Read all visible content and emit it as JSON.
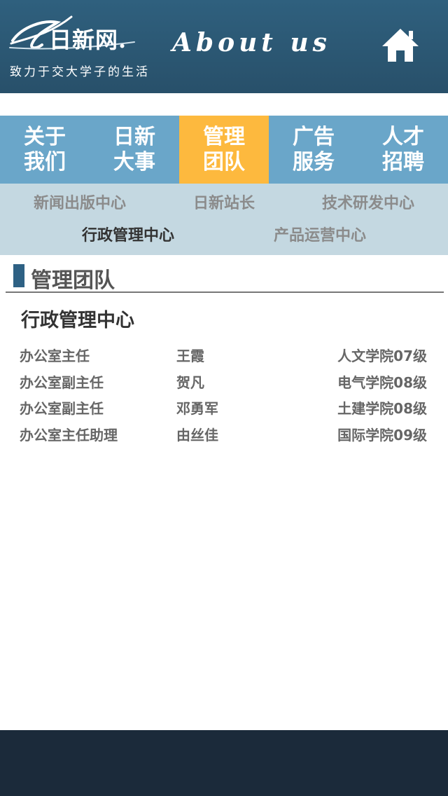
{
  "header": {
    "logo_text": "日新网.",
    "slogan": "致力于交大学子的生活",
    "title": "About us",
    "home_icon": "home-icon",
    "bg_color": "#2b5570"
  },
  "tabs": [
    {
      "label": "关于我们",
      "active": false
    },
    {
      "label": "日新大事",
      "active": false
    },
    {
      "label": "管理团队",
      "active": true
    },
    {
      "label": "广告服务",
      "active": false
    },
    {
      "label": "人才招聘",
      "active": false
    }
  ],
  "accent_color": "#fdb93e",
  "tab_color": "#6aa6c9",
  "subnav": {
    "row1": [
      "新闻出版中心",
      "日新站长",
      "技术研发中心"
    ],
    "row2": [
      "行政管理中心",
      "产品运营中心"
    ],
    "active": "行政管理中心"
  },
  "section": {
    "title": "管理团队",
    "department": "行政管理中心"
  },
  "staff": [
    {
      "role": "办公室主任",
      "name": "王霞",
      "dept": "人文学院07级"
    },
    {
      "role": "办公室副主任",
      "name": "贺凡",
      "dept": "电气学院08级"
    },
    {
      "role": "办公室副主任",
      "name": "邓勇军",
      "dept": "土建学院08级"
    },
    {
      "role": "办公室主任助理",
      "name": "由丝佳",
      "dept": "国际学院09级"
    }
  ]
}
